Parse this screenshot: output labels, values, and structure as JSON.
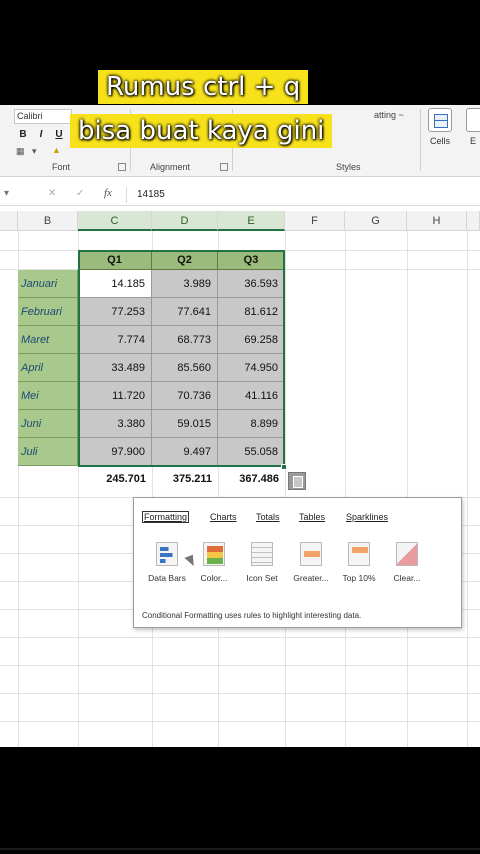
{
  "caption": {
    "line1": "Rumus ctrl + q",
    "line2": "bisa buat kaya gini"
  },
  "ribbon": {
    "font_name": "Calibri",
    "bold": "B",
    "italic": "I",
    "underline": "U",
    "group_font": "Font",
    "group_alignment": "Alignment",
    "group_styles": "Styles",
    "styles_partial": "atting ~",
    "cells": "Cells",
    "next_partial": "E"
  },
  "formula_bar": {
    "fx": "fx",
    "value": "14185"
  },
  "columns": [
    "B",
    "C",
    "D",
    "E",
    "F",
    "G",
    "H"
  ],
  "table": {
    "headers": [
      "Q1",
      "Q2",
      "Q3"
    ],
    "rows": [
      {
        "month": "Januari",
        "values": [
          "14.185",
          "3.989",
          "36.593"
        ]
      },
      {
        "month": "Februari",
        "values": [
          "77.253",
          "77.641",
          "81.612"
        ]
      },
      {
        "month": "Maret",
        "values": [
          "7.774",
          "68.773",
          "69.258"
        ]
      },
      {
        "month": "April",
        "values": [
          "33.489",
          "85.560",
          "74.950"
        ]
      },
      {
        "month": "Mei",
        "values": [
          "11.720",
          "70.736",
          "41.116"
        ]
      },
      {
        "month": "Juni",
        "values": [
          "3.380",
          "59.015",
          "8.899"
        ]
      },
      {
        "month": "Juli",
        "values": [
          "97.900",
          "9.497",
          "55.058"
        ]
      }
    ],
    "totals": [
      "245.701",
      "375.211",
      "367.486"
    ]
  },
  "quick_analysis": {
    "tabs": [
      "Formatting",
      "Charts",
      "Totals",
      "Tables",
      "Sparklines"
    ],
    "options": [
      "Data Bars",
      "Color...",
      "Icon Set",
      "Greater...",
      "Top 10%",
      "Clear..."
    ],
    "description": "Conditional Formatting uses rules to highlight interesting data."
  },
  "colors": {
    "header_green": "#9bbb7c",
    "month_green": "#a9c88b",
    "value_gray": "#c8c8c8",
    "selection_border": "#217346",
    "caption_bg": "#f6e11b"
  }
}
